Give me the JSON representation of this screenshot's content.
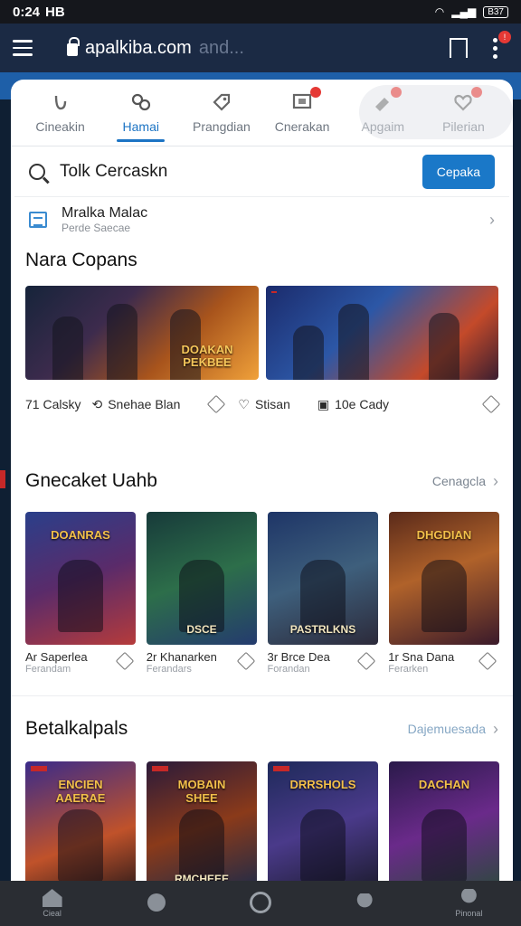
{
  "status": {
    "time": "0:24",
    "carrier": "HB",
    "battery": "B37"
  },
  "browser": {
    "url_main": "apalkiba.com",
    "url_fade": "and...",
    "notif_count": "!"
  },
  "tabs": [
    {
      "label": "Cineakin",
      "icon": "refresh-icon"
    },
    {
      "label": "Hamai",
      "icon": "controller-icon",
      "active": true
    },
    {
      "label": "Prangdian",
      "icon": "tag-icon"
    },
    {
      "label": "Cnerakan",
      "icon": "monitor-icon"
    },
    {
      "label": "Apgaim",
      "icon": "megaphone-icon"
    },
    {
      "label": "Pilerian",
      "icon": "heart-icon"
    }
  ],
  "search": {
    "query": "Tolk Cercaskn",
    "button": "Cepaka"
  },
  "info": {
    "title": "Mralka Malac",
    "subtitle": "Perde Saecae"
  },
  "section1": {
    "title": "Nara Copans",
    "banners": [
      {
        "title": "DOAKAN\nPEKBEE"
      },
      {
        "title": ""
      }
    ],
    "meta": [
      "71 Calsky",
      "Snehae Blan",
      "Stisan",
      "10e Cady"
    ]
  },
  "section2": {
    "title": "Gnecaket Uahb",
    "more": "Cenagcla",
    "tiles": [
      {
        "top": "DOANRAS",
        "bottom": "",
        "a": "Ar Saperlea",
        "b": "Ferandam"
      },
      {
        "top": "",
        "bottom": "DSCE",
        "a": "2r Khanarken",
        "b": "Ferandars"
      },
      {
        "top": "",
        "bottom": "PASTRLKNS",
        "a": "3r Brce Dea",
        "b": "Forandan"
      },
      {
        "top": "DHGDIAN",
        "bottom": "",
        "a": "1r Sna Dana",
        "b": "Ferarken"
      }
    ]
  },
  "section3": {
    "title": "Betalkalpals",
    "more": "Dajemuesada",
    "tiles": [
      {
        "top": "ENCIEN\nAAERAE",
        "bottom": ""
      },
      {
        "top": "MOBAIN\nSHEE",
        "bottom": "RMCHEEE"
      },
      {
        "top": "DRRSHOLS",
        "bottom": ""
      },
      {
        "top": "DACHAN",
        "bottom": ""
      }
    ]
  },
  "bottom_nav": [
    {
      "label": "Cieal",
      "icon": "home-icon"
    },
    {
      "label": "",
      "icon": "search-icon"
    },
    {
      "label": "",
      "icon": "record-icon"
    },
    {
      "label": "",
      "icon": "profile-icon"
    },
    {
      "label": "Pinonal",
      "icon": "account-icon"
    }
  ],
  "colors": {
    "accent": "#1c74c4",
    "header": "#1b2a44",
    "alert": "#e53935"
  }
}
